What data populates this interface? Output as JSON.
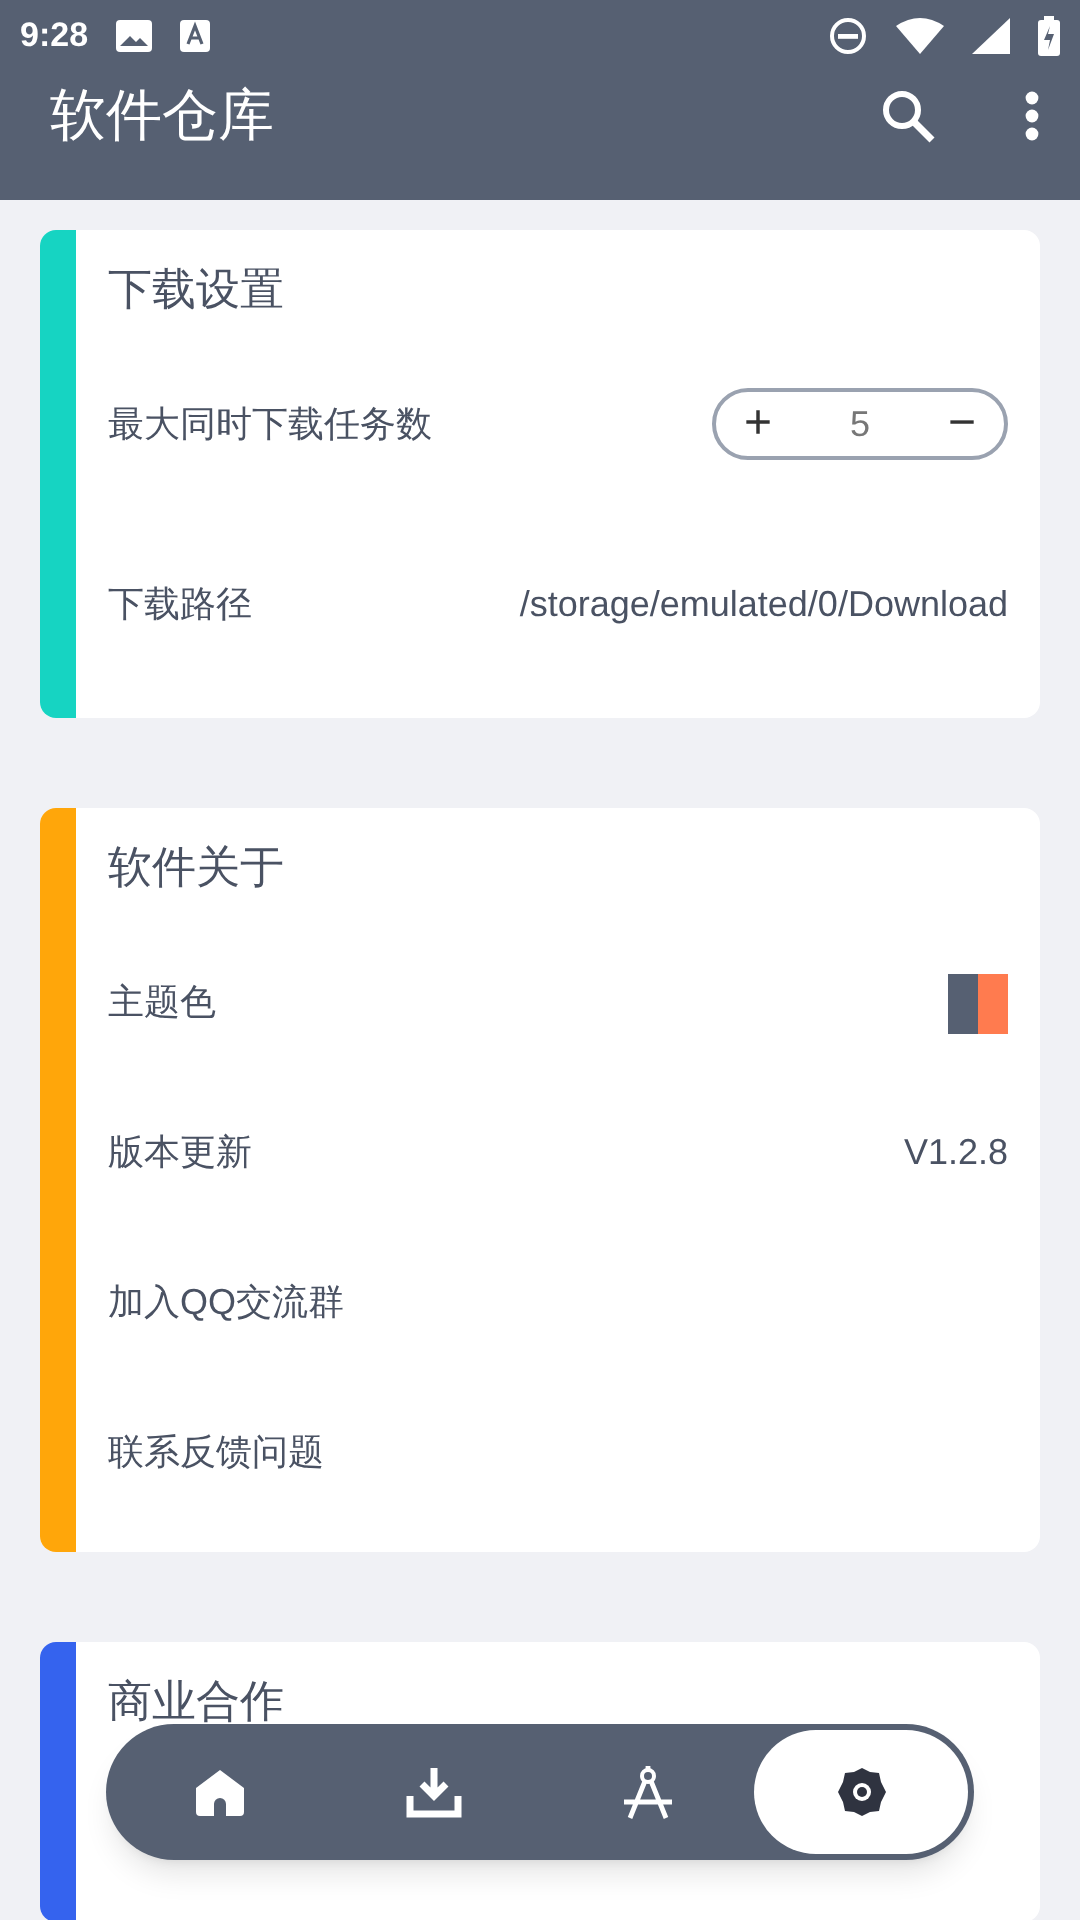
{
  "status_bar": {
    "time": "9:28"
  },
  "app_bar": {
    "title": "软件仓库"
  },
  "cards": [
    {
      "title": "下载设置",
      "color": "#16d4c2",
      "rows": [
        {
          "kind": "stepper",
          "label": "最大同时下载任务数",
          "value": "5",
          "plus": "+",
          "minus": "−"
        },
        {
          "kind": "text",
          "label": "下载路径",
          "value": "/storage/emulated/0/Download"
        }
      ]
    },
    {
      "title": "软件关于",
      "color": "#ffa60a",
      "rows": [
        {
          "kind": "swatch",
          "label": "主题色",
          "swatches": [
            {
              "color": "#566072"
            },
            {
              "color": "#ff7b4f"
            }
          ]
        },
        {
          "kind": "text",
          "label": "版本更新",
          "value": "V1.2.8"
        },
        {
          "kind": "plain",
          "label": "加入QQ交流群"
        },
        {
          "kind": "plain",
          "label": "联系反馈问题"
        }
      ]
    },
    {
      "title": "商业合作",
      "color": "#3563ee"
    }
  ],
  "nav": [
    {
      "kind": "home",
      "selected": false
    },
    {
      "kind": "download",
      "selected": false
    },
    {
      "kind": "compass",
      "selected": false
    },
    {
      "kind": "settings",
      "selected": true
    }
  ]
}
